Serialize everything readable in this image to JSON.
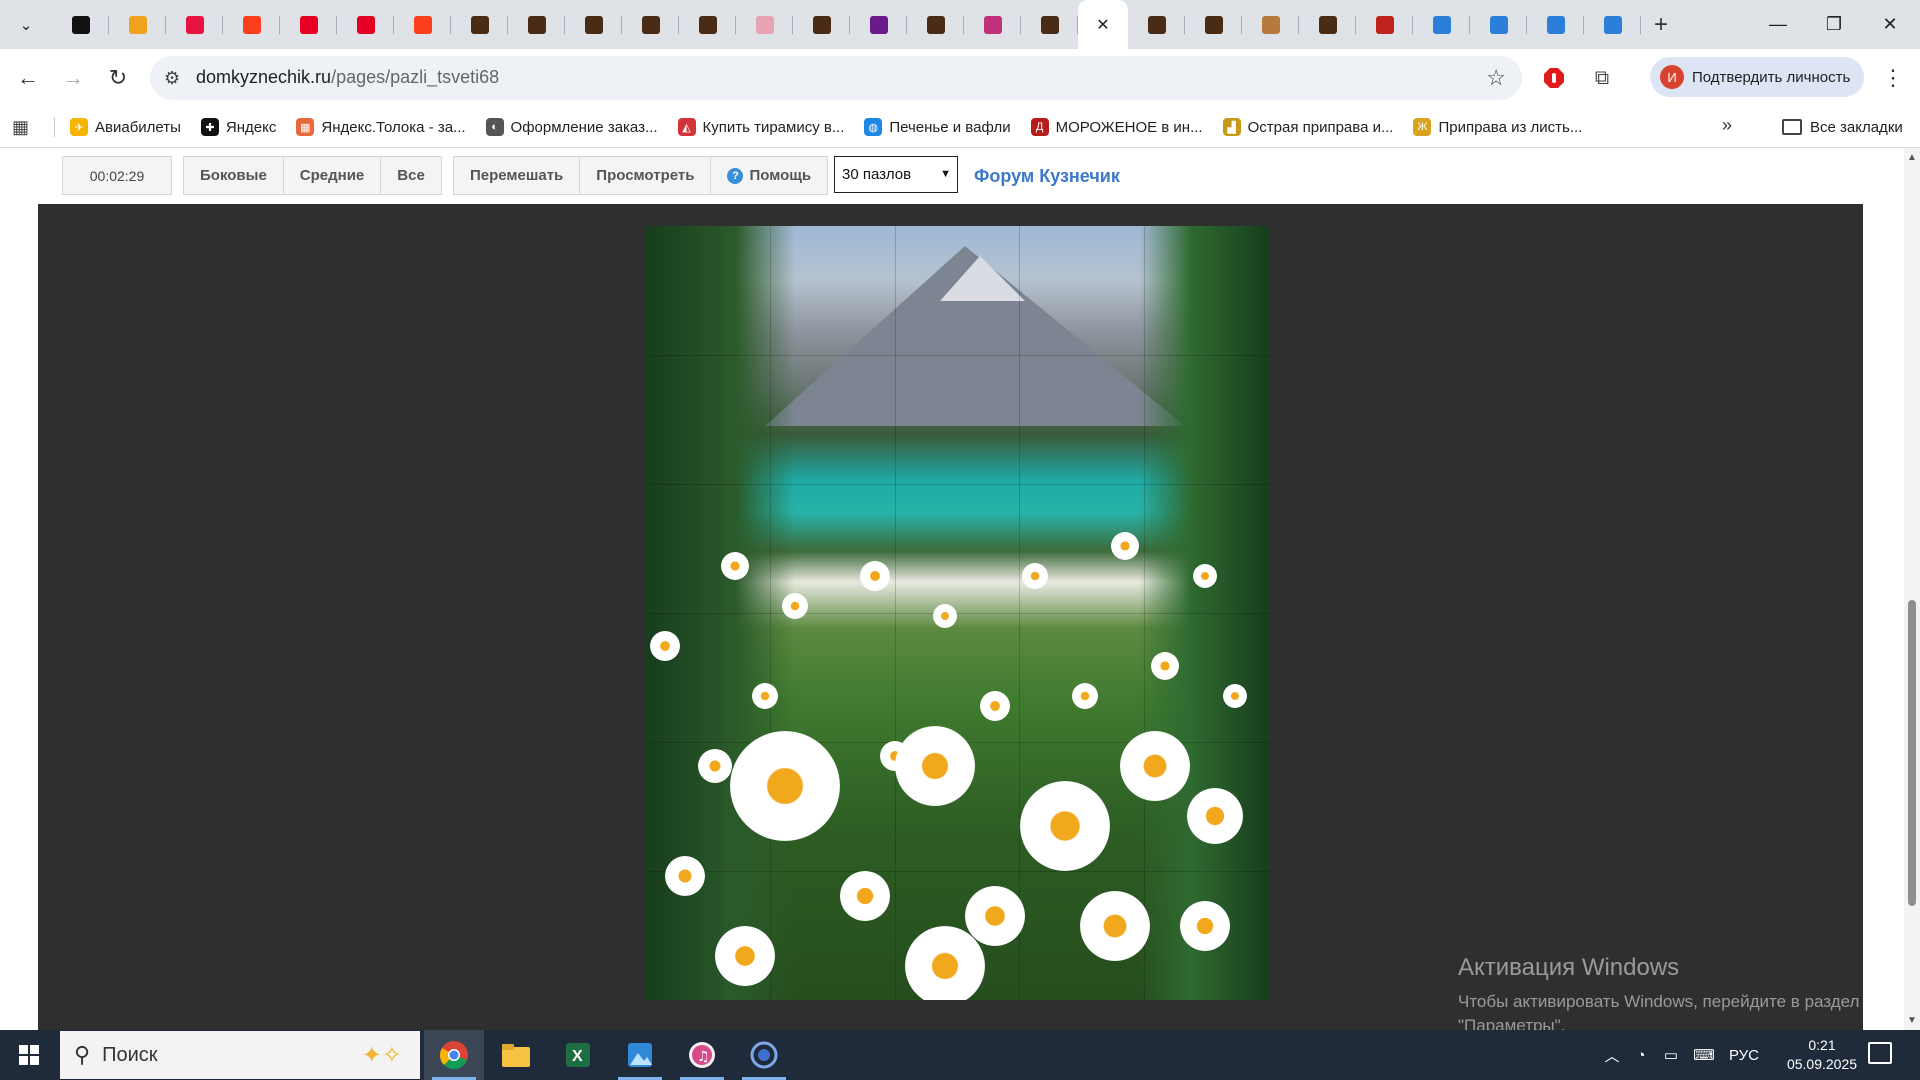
{
  "browser": {
    "tabs": [
      {
        "icon": "star-badge-icon",
        "color": "#111111"
      },
      {
        "icon": "sun-logo-icon",
        "color": "#f0a21e"
      },
      {
        "icon": "ozon-icon",
        "color": "#e8133f"
      },
      {
        "icon": "yandex-icon",
        "color": "#fc3f1d"
      },
      {
        "icon": "pinterest-icon",
        "color": "#e60023"
      },
      {
        "icon": "pinterest-icon",
        "color": "#e60023"
      },
      {
        "icon": "yandex-icon",
        "color": "#fc3f1d"
      },
      {
        "icon": "puzzle-favicon",
        "color": "#4a2b16"
      },
      {
        "icon": "puzzle-favicon",
        "color": "#4a2b16"
      },
      {
        "icon": "puzzle-favicon",
        "color": "#4a2b16"
      },
      {
        "icon": "puzzle-favicon",
        "color": "#4a2b16"
      },
      {
        "icon": "puzzle-favicon",
        "color": "#4a2b16"
      },
      {
        "icon": "cake-icon",
        "color": "#e7a3b3"
      },
      {
        "icon": "puzzle-favicon",
        "color": "#4a2b16"
      },
      {
        "icon": "film-icon",
        "color": "#6a1a8a"
      },
      {
        "icon": "puzzle-favicon",
        "color": "#4a2b16"
      },
      {
        "icon": "game-icon",
        "color": "#c0337a"
      },
      {
        "icon": "puzzle-favicon",
        "color": "#4a2b16"
      },
      {
        "icon": "active-tab-close",
        "color": "#ffffff",
        "active": true
      },
      {
        "icon": "puzzle-favicon",
        "color": "#4a2b16"
      },
      {
        "icon": "puzzle-favicon",
        "color": "#4a2b16"
      },
      {
        "icon": "dog-icon",
        "color": "#b57a3c"
      },
      {
        "icon": "puzzle-favicon",
        "color": "#4a2b16"
      },
      {
        "icon": "red-art-icon",
        "color": "#c0221d"
      },
      {
        "icon": "blue-square-icon",
        "color": "#2b7fd9"
      },
      {
        "icon": "blue-square-icon",
        "color": "#2b7fd9"
      },
      {
        "icon": "blue-square-icon",
        "color": "#2b7fd9"
      },
      {
        "icon": "blue-square-icon",
        "color": "#2b7fd9"
      }
    ],
    "url_host": "domkyznechik.ru",
    "url_path": "/pages/pazli_tsveti68",
    "profile_initial": "И",
    "profile_label": "Подтвердить личность"
  },
  "bookmarks": {
    "items": [
      {
        "label": "Авиабилеты",
        "color": "#f4b400",
        "glyph": "✈"
      },
      {
        "label": "Яндекс",
        "color": "#111111",
        "glyph": "✚"
      },
      {
        "label": "Яндекс.Толока - за...",
        "color": "#e86a3a",
        "glyph": "▦"
      },
      {
        "label": "Оформление заказ...",
        "color": "#555555",
        "glyph": "◐"
      },
      {
        "label": "Купить тирамису в...",
        "color": "#d2343a",
        "glyph": "◭"
      },
      {
        "label": "Печенье и вафли",
        "color": "#1e88e5",
        "glyph": "◍"
      },
      {
        "label": "МОРОЖЕНОЕ в ин...",
        "color": "#b71c1c",
        "glyph": "Д"
      },
      {
        "label": "Острая приправа и...",
        "color": "#c49a18",
        "glyph": "▟"
      },
      {
        "label": "Приправа из листь...",
        "color": "#d9a320",
        "glyph": "Ж"
      }
    ],
    "all_label": "Все закладки"
  },
  "puzzle_page": {
    "timer": "00:02:29",
    "group1": [
      "Боковые",
      "Средние",
      "Все"
    ],
    "group2": [
      "Перемешать",
      "Просмотреть",
      "Помощь"
    ],
    "select_value": "30 пазлов",
    "forum_link": "Форум Кузнечик"
  },
  "activation": {
    "title": "Активация Windows",
    "line1": "Чтобы активировать Windows, перейдите в раздел",
    "line2": "\"Параметры\"."
  },
  "taskbar": {
    "search_label": "Поиск",
    "lang": "РУС",
    "time": "0:21",
    "date": "05.09.2025"
  }
}
